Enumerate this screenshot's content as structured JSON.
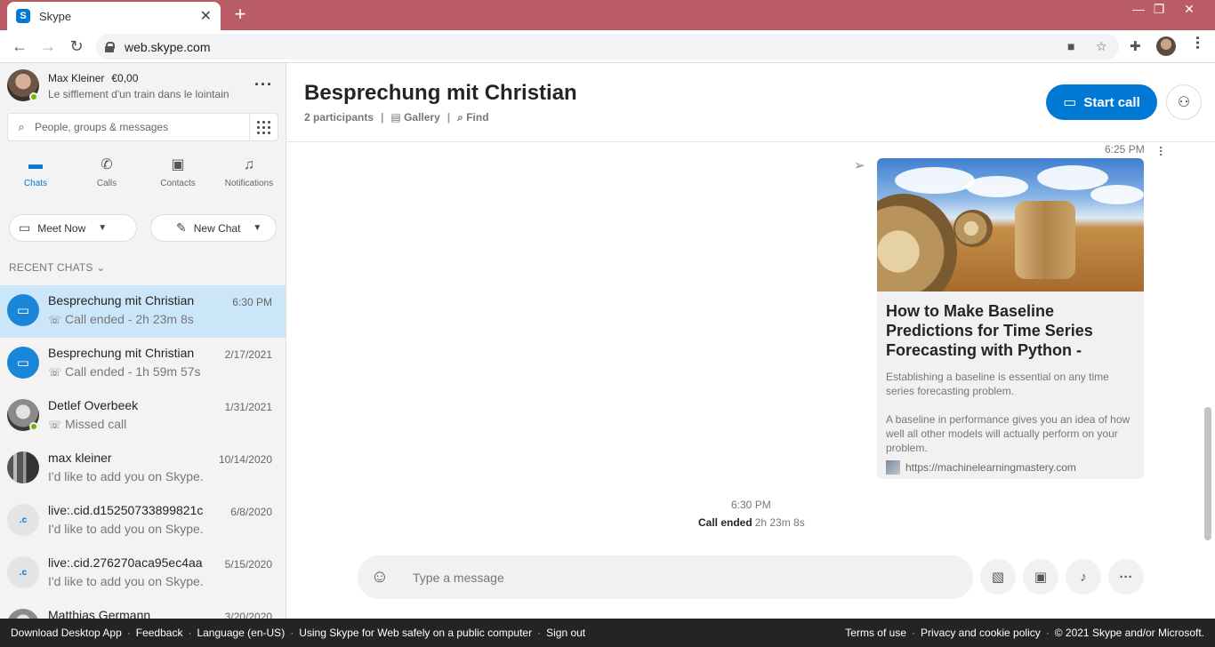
{
  "browser": {
    "tab_title": "Skype",
    "tab_favicon": "S",
    "url": "web.skype.com",
    "new_tab_icon": "plus-icon",
    "accent_color": "#b95c65"
  },
  "profile": {
    "name": "Max Kleiner",
    "credit": "€0,00",
    "mood": "Le sifflement d'un train dans le lointain",
    "status_color": "#6bb700"
  },
  "search": {
    "placeholder": "People, groups & messages"
  },
  "nav": {
    "chats": "Chats",
    "calls": "Calls",
    "contacts": "Contacts",
    "notifications": "Notifications"
  },
  "actions": {
    "meet_now": "Meet Now",
    "new_chat": "New Chat"
  },
  "recent_header": "RECENT CHATS",
  "chats": [
    {
      "name": "Besprechung mit Christian",
      "time": "6:30 PM",
      "sub": "Call ended - 2h 23m 8s"
    },
    {
      "name": "Besprechung mit Christian",
      "time": "2/17/2021",
      "sub": "Call ended - 1h 59m 57s"
    },
    {
      "name": "Detlef Overbeek",
      "time": "1/31/2021",
      "sub": "Missed call"
    },
    {
      "name": "max kleiner",
      "time": "10/14/2020",
      "sub": "I'd like to add you on Skype."
    },
    {
      "name": "live:.cid.d15250733899821c",
      "time": "6/8/2020",
      "sub": "I'd like to add you on Skype.",
      "initials": ".c"
    },
    {
      "name": "live:.cid.276270aca95ec4aa",
      "time": "5/15/2020",
      "sub": "I'd like to add you on Skype.",
      "initials": ".c"
    },
    {
      "name": "Matthias Germann",
      "time": "3/20/2020",
      "sub": ""
    }
  ],
  "conversation": {
    "title": "Besprechung mit Christian",
    "participants": "2 participants",
    "gallery": "Gallery",
    "find": "Find",
    "start_call": "Start call",
    "message_time": "6:25 PM",
    "card": {
      "title": "How to Make Baseline Predictions for Time Series Forecasting with Python -",
      "desc1": "Establishing a baseline is essential on any time series forecasting problem.",
      "desc2": "A baseline in performance gives you an idea of how well all other models will actually perform on your problem.",
      "url": "https://machinelearningmastery.com"
    },
    "call_time": "6:30 PM",
    "call_ended_label": "Call ended",
    "call_ended_duration": "2h 23m 8s",
    "composer_placeholder": "Type a message",
    "brand_color": "#0078d4"
  },
  "footer": {
    "download": "Download Desktop App",
    "feedback": "Feedback",
    "language": "Language (en-US)",
    "safely": "Using Skype for Web safely on a public computer",
    "signout": "Sign out",
    "terms": "Terms of use",
    "privacy": "Privacy and cookie policy",
    "copyright": "© 2021 Skype and/or Microsoft."
  }
}
